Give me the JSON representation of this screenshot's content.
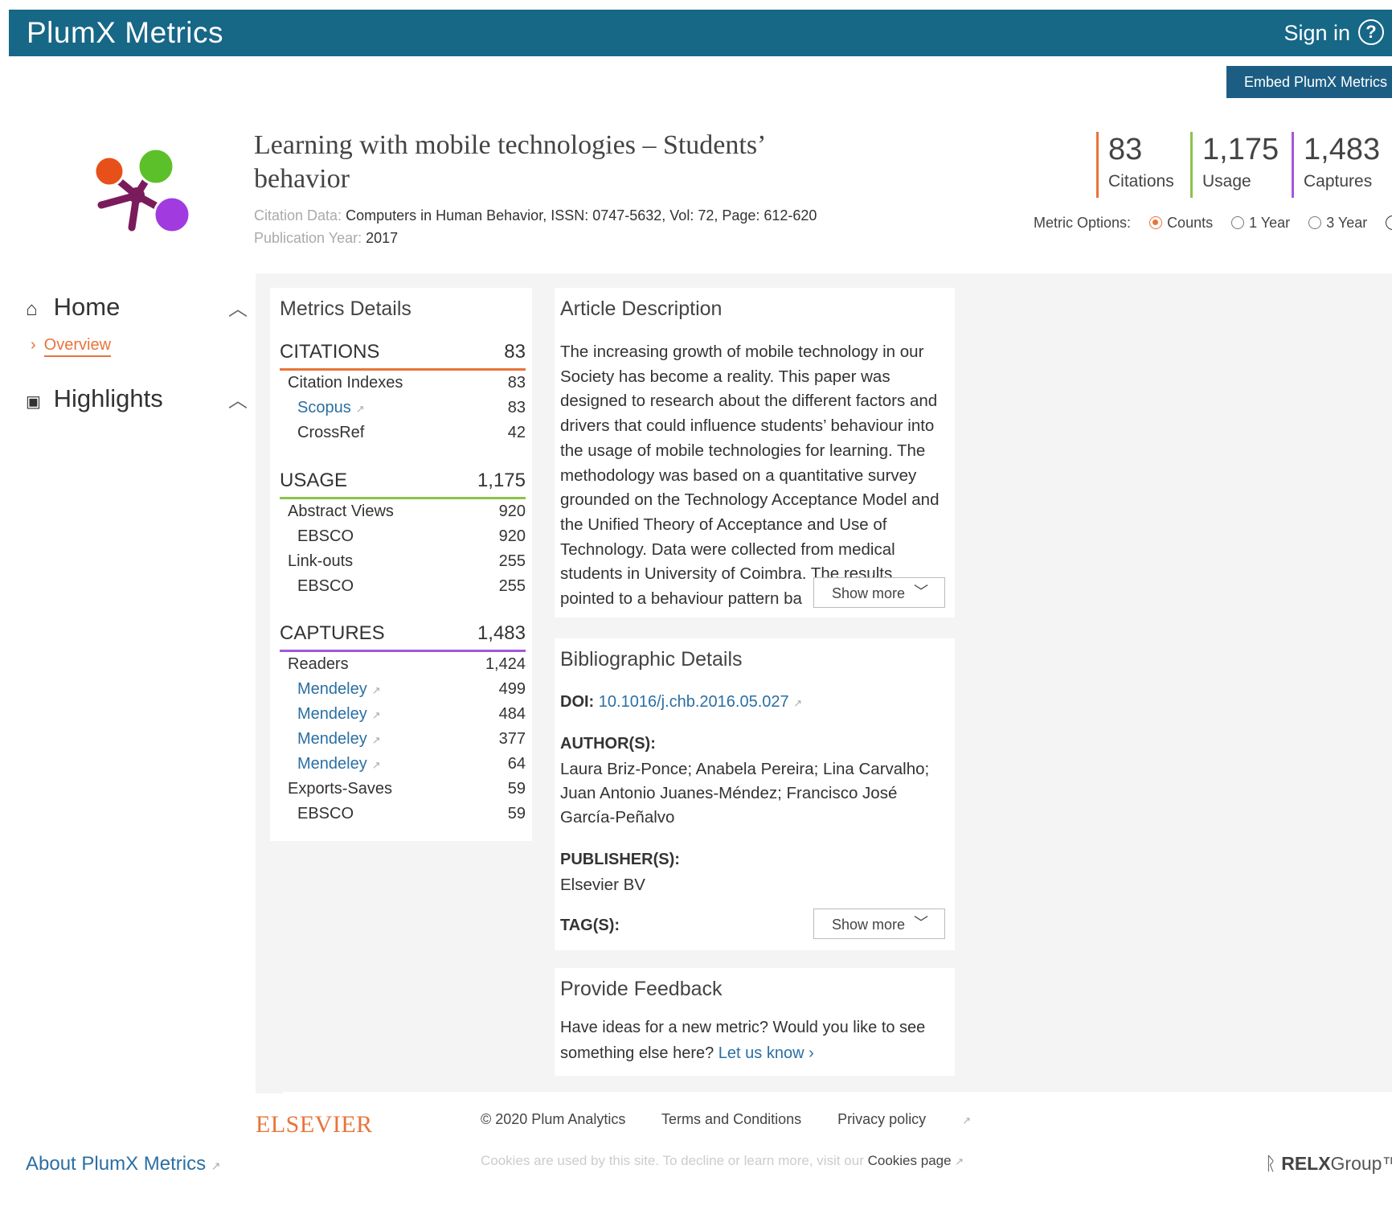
{
  "header": {
    "brand": "PlumX Metrics",
    "signin": "Sign in",
    "help_icon": "?"
  },
  "embed_button": "Embed PlumX Metrics",
  "article": {
    "title_line1": "Learning with mobile technologies – Students’",
    "title_line2": "behavior",
    "citation_label": "Citation Data:",
    "citation_value": "Computers in Human Behavior, ISSN: 0747-5632, Vol: 72, Page: 612-620",
    "pub_label": "Publication Year:",
    "pub_value": "2017"
  },
  "summary": [
    {
      "num": "83",
      "label": "Citations",
      "color": "#e8743b"
    },
    {
      "num": "1,175",
      "label": "Usage",
      "color": "#8bc34a"
    },
    {
      "num": "1,483",
      "label": "Captures",
      "color": "#a259d9"
    }
  ],
  "metric_options": {
    "label": "Metric Options:",
    "options": [
      "Counts",
      "1 Year",
      "3 Year"
    ],
    "selected": "Counts"
  },
  "sidebar": {
    "home": "Home",
    "overview": "Overview",
    "highlights": "Highlights",
    "about": "About PlumX Metrics"
  },
  "metrics_details": {
    "title": "Metrics Details",
    "citations": {
      "label": "CITATIONS",
      "total": "83",
      "rows": [
        {
          "label": "Citation Indexes",
          "value": "83"
        },
        {
          "label": "Scopus",
          "value": "83"
        },
        {
          "label": "CrossRef",
          "value": "42"
        }
      ]
    },
    "usage": {
      "label": "USAGE",
      "total": "1,175",
      "rows": [
        {
          "label": "Abstract Views",
          "value": "920"
        },
        {
          "label": "EBSCO",
          "value": "920"
        },
        {
          "label": "Link-outs",
          "value": "255"
        },
        {
          "label": "EBSCO",
          "value": "255"
        }
      ]
    },
    "captures": {
      "label": "CAPTURES",
      "total": "1,483",
      "rows": [
        {
          "label": "Readers",
          "value": "1,424"
        },
        {
          "label": "Mendeley",
          "value": "499"
        },
        {
          "label": "Mendeley",
          "value": "484"
        },
        {
          "label": "Mendeley",
          "value": "377"
        },
        {
          "label": "Mendeley",
          "value": "64"
        },
        {
          "label": "Exports-Saves",
          "value": "59"
        },
        {
          "label": "EBSCO",
          "value": "59"
        }
      ]
    }
  },
  "article_description": {
    "title": "Article Description",
    "text": "The increasing growth of mobile technology in our Society has become a reality. This paper was designed to research about the different factors and drivers that could influence students’ behaviour into the usage of mobile technologies for learning. The methodology was based on a quantitative survey grounded on the Technology Acceptance Model and the Unified Theory of Acceptance and Use of Technology. Data were collected from medical students in University of Coimbra. The results pointed to a behaviour pattern ba",
    "show_more": "Show more"
  },
  "bibliographic": {
    "title": "Bibliographic Details",
    "doi_label": "DOI:",
    "doi_value": "10.1016/j.chb.2016.05.027",
    "authors_label": "AUTHOR(S):",
    "authors": "Laura Briz-Ponce; Anabela Pereira; Lina Carvalho; Juan Antonio Juanes-Méndez; Francisco José García-Peñalvo",
    "publishers_label": "PUBLISHER(S):",
    "publishers": "Elsevier BV",
    "tags_label": "TAG(S):",
    "show_more": "Show more"
  },
  "feedback": {
    "title": "Provide Feedback",
    "text": "Have ideas for a new metric? Would you like to see something else here?",
    "link": "Let us know"
  },
  "footer": {
    "elsevier": "ELSEVIER",
    "copyright": "© 2020 Plum Analytics",
    "terms": "Terms and Conditions",
    "privacy": "Privacy policy",
    "cookies_text": "Cookies are used by this site. To decline or learn more, visit our",
    "cookies_link": "Cookies page",
    "relx_bold": "RELX",
    "relx_rest": "Group™"
  },
  "colors": {
    "header": "#176787",
    "citations": "#e8743b",
    "usage": "#8bc34a",
    "captures": "#a259d9",
    "link": "#2b6fa3"
  }
}
